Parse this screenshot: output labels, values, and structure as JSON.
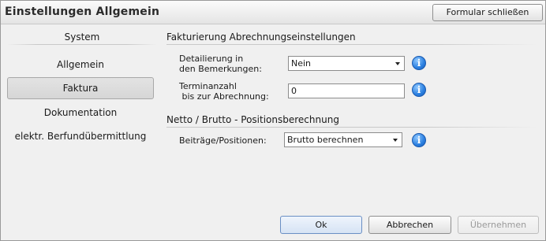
{
  "window": {
    "title": "Einstellungen Allgemein",
    "close_form_label": "Formular schließen"
  },
  "sidebar": {
    "header": "System",
    "items": [
      {
        "label": "Allgemein",
        "active": false
      },
      {
        "label": "Faktura",
        "active": true
      },
      {
        "label": "Dokumentation",
        "active": false
      },
      {
        "label": "elektr. Berfundübermittlung",
        "active": false
      }
    ]
  },
  "sections": {
    "billing": {
      "title": "Fakturierung Abrechnungseinstellungen",
      "detail_label": "Detailierung in\nden Bemerkungen:",
      "detail_value": "Nein",
      "count_label": "Terminanzahl\n bis zur Abrechnung:",
      "count_value": "0"
    },
    "netto": {
      "title": "Netto / Brutto - Positionsberechnung",
      "positions_label": "Beiträge/Positionen:",
      "positions_value": "Brutto berechnen"
    }
  },
  "footer": {
    "ok_label": "Ok",
    "cancel_label": "Abbrechen",
    "apply_label": "Übernehmen"
  },
  "colors": {
    "info_icon": "#2a7fe0",
    "primary_button_border": "#6a8fc4"
  }
}
